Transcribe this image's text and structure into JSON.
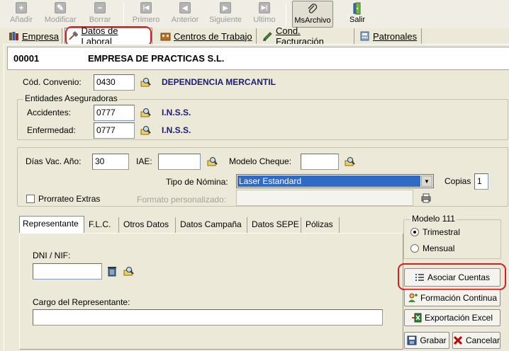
{
  "toolbar": {
    "buttons": [
      {
        "label": "Añadir",
        "icon": "+"
      },
      {
        "label": "Modificar",
        "icon": "✎"
      },
      {
        "label": "Borrar",
        "icon": "−"
      },
      {
        "label": "Primero",
        "icon": "|◀"
      },
      {
        "label": "Anterior",
        "icon": "◀"
      },
      {
        "label": "Siguiente",
        "icon": "▶"
      },
      {
        "label": "Ultimo",
        "icon": "▶|"
      },
      {
        "label": "MsArchivo",
        "icon": "📎"
      },
      {
        "label": "Salir",
        "icon": "🚪"
      }
    ]
  },
  "tabs": [
    {
      "label": "Empresa"
    },
    {
      "label": "Datos de Laboral"
    },
    {
      "label": "Centros de Trabajo"
    },
    {
      "label": "Cond. Facturación"
    },
    {
      "label": "Patronales"
    }
  ],
  "company": {
    "code": "00001",
    "name": "EMPRESA DE PRACTICAS S.L."
  },
  "convenio": {
    "label": "Cód. Convenio:",
    "value": "0430",
    "description": "DEPENDENCIA MERCANTIL"
  },
  "entidades": {
    "legend": "Entidades Aseguradoras",
    "accidentes": {
      "label": "Accidentes:",
      "value": "0777",
      "description": "I.N.S.S."
    },
    "enfermedad": {
      "label": "Enfermedad:",
      "value": "0777",
      "description": "I.N.S.S."
    }
  },
  "params": {
    "dias_vac": {
      "label": "Días Vac. Año:",
      "value": "30"
    },
    "iae": {
      "label": "IAE:",
      "value": ""
    },
    "modelo_cheque": {
      "label": "Modelo Cheque:",
      "value": ""
    },
    "tipo_nomina": {
      "label": "Tipo de Nómina:",
      "value": "Laser Estandard"
    },
    "copias": {
      "label": "Copias",
      "value": "1"
    },
    "prorrateo": {
      "label": "Prorrateo Extras",
      "checked": false
    },
    "formato": {
      "label": "Formato personalizado:",
      "value": ""
    }
  },
  "inner_tabs": [
    {
      "label": "Representante"
    },
    {
      "label": "F.L.C."
    },
    {
      "label": "Otros Datos"
    },
    {
      "label": "Datos Campaña"
    },
    {
      "label": "Datos SEPE"
    },
    {
      "label": "Pólizas"
    }
  ],
  "representante": {
    "dni_label": "DNI / NIF:",
    "dni_value": "",
    "cargo_label": "Cargo del Representante:",
    "cargo_value": ""
  },
  "modelo111": {
    "legend": "Modelo 111",
    "options": [
      {
        "label": "Trimestral",
        "selected": true
      },
      {
        "label": "Mensual",
        "selected": false
      }
    ]
  },
  "actions": {
    "asociar": "Asociar Cuentas",
    "formacion": "Formación Continua",
    "exportacion": "Exportación Excel",
    "grabar": "Grabar",
    "cancelar": "Cancelar"
  },
  "colors": {
    "highlight": "#d62020",
    "selection": "#316ac5",
    "label_blue": "#1a1a7a"
  }
}
